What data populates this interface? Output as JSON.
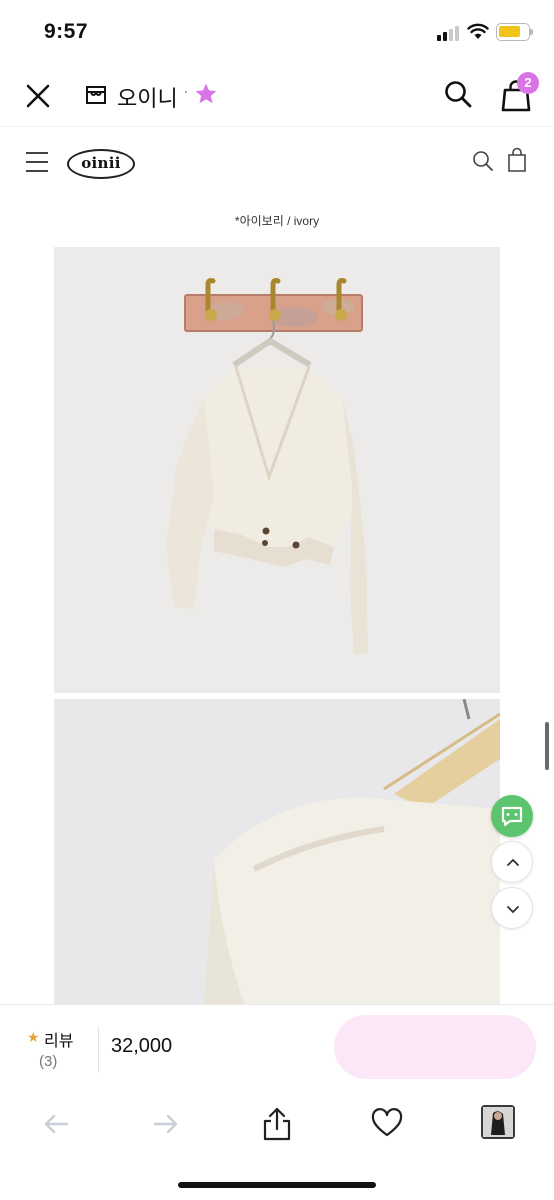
{
  "status_bar": {
    "time": "9:57"
  },
  "app_header": {
    "store_name": "오이니",
    "separator": "·",
    "cart_count": "2"
  },
  "site_nav": {
    "logo": "oinii"
  },
  "product": {
    "color_caption": "*아이보리 / ivory",
    "product_color": "ivory"
  },
  "purchase_bar": {
    "review_label": "리뷰",
    "review_count": "(3)",
    "price": "32,000"
  },
  "colors": {
    "accent_pink": "#d974e6",
    "buy_button": "#fbe7f7",
    "chat_green": "#5cc46e",
    "review_star": "#e8a33c"
  },
  "icons": {
    "close": "close-icon",
    "store": "store-icon",
    "favorite": "star-icon",
    "search": "search-icon",
    "bag": "shopping-bag-icon",
    "menu": "hamburger-icon",
    "cart": "cart-icon",
    "chat": "chat-icon",
    "scroll_up": "chevron-up-icon",
    "scroll_down": "chevron-down-icon",
    "back": "back-arrow-icon",
    "forward": "forward-arrow-icon",
    "share": "share-icon",
    "wishlist": "heart-icon"
  }
}
